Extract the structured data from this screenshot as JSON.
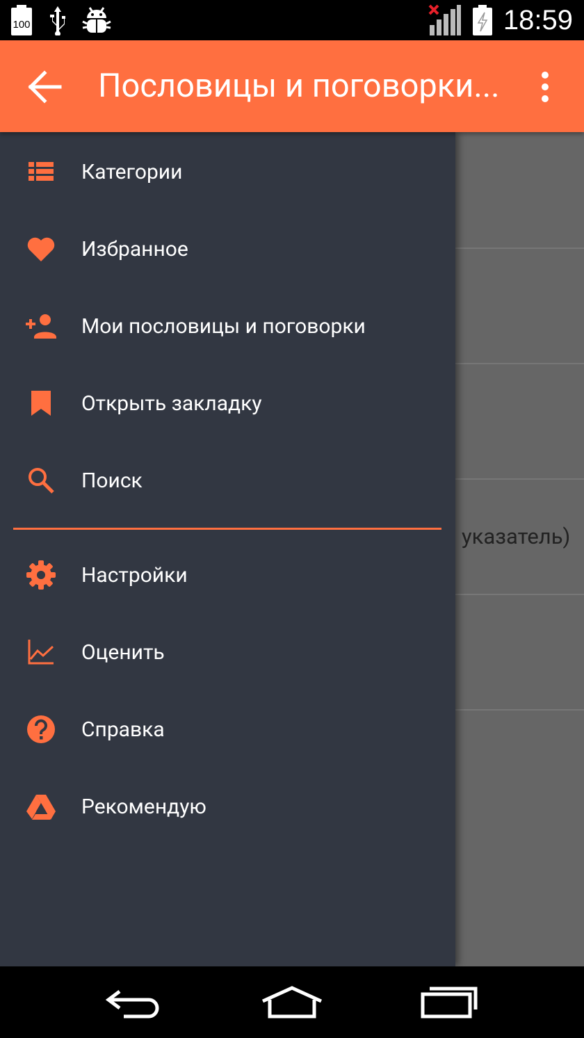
{
  "status_bar": {
    "battery_level_label": "100",
    "time": "18:59",
    "icons": [
      "battery-icon",
      "usb-icon",
      "android-debug-icon",
      "signal-no-data-icon",
      "battery-charging-icon"
    ]
  },
  "app_bar": {
    "title": "Пословицы и поговорки...",
    "icons": [
      "back-arrow-icon",
      "overflow-menu-icon"
    ]
  },
  "drawer": {
    "accent_color": "#ff6f40",
    "background_color": "#323742",
    "items": [
      {
        "label": "Категории",
        "icon": "list-icon"
      },
      {
        "label": "Избранное",
        "icon": "heart-icon"
      },
      {
        "label": "Мои пословицы и поговорки",
        "icon": "add-person-icon"
      },
      {
        "label": "Открыть закладку",
        "icon": "bookmark-icon"
      },
      {
        "label": "Поиск",
        "icon": "search-icon"
      }
    ],
    "secondary_items": [
      {
        "label": "Настройки",
        "icon": "gear-icon"
      },
      {
        "label": "Оценить",
        "icon": "line-chart-icon"
      },
      {
        "label": "Справка",
        "icon": "help-icon"
      },
      {
        "label": "Рекомендую",
        "icon": "drive-icon"
      }
    ]
  },
  "background_content": {
    "visible_fragment": "указатель)"
  },
  "nav_bar": {
    "icons": [
      "back-icon",
      "home-icon",
      "recent-apps-icon"
    ]
  }
}
